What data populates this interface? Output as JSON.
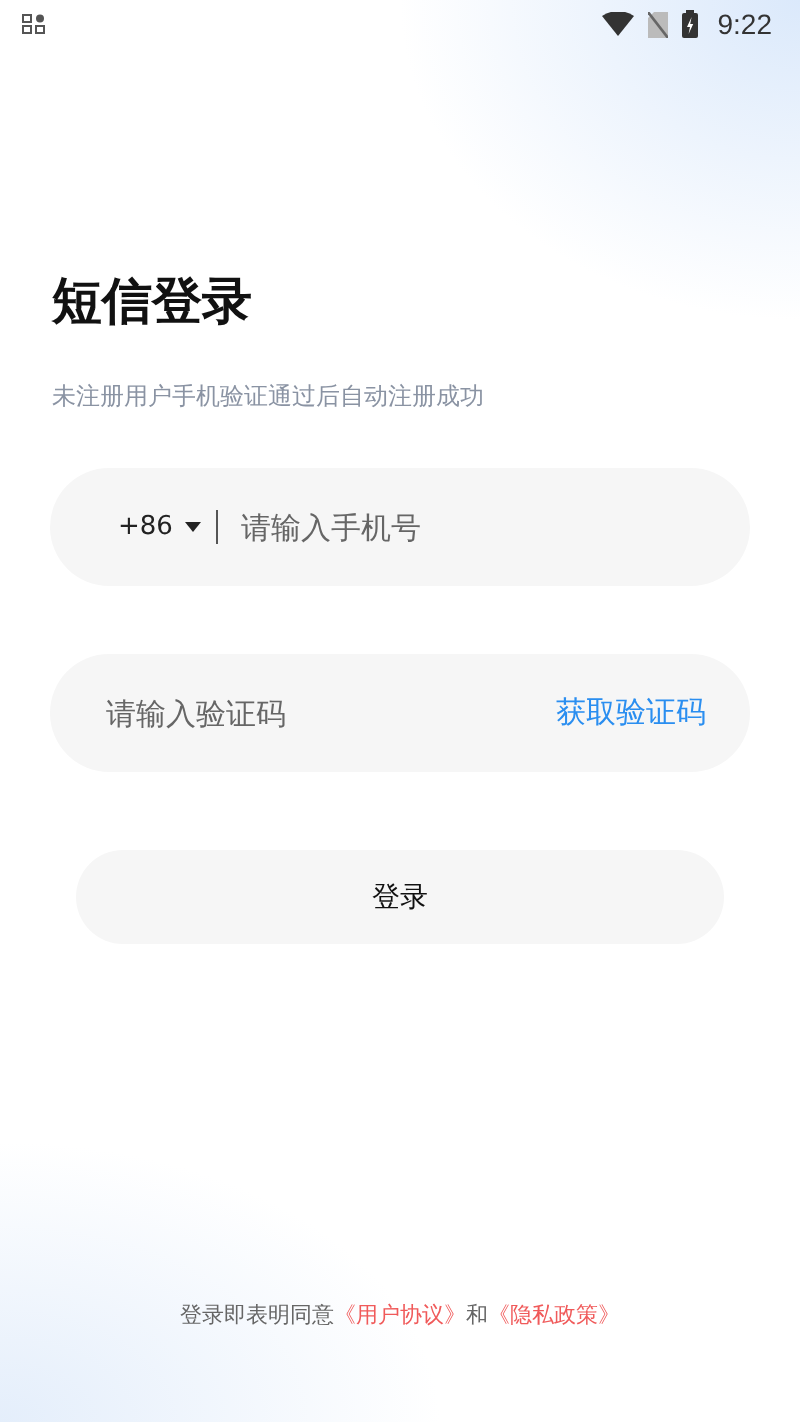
{
  "status_bar": {
    "time": "9:22"
  },
  "title": "短信登录",
  "subtitle": "未注册用户手机验证通过后自动注册成功",
  "phone_field": {
    "country_code": "+86",
    "placeholder": "请输入手机号"
  },
  "code_field": {
    "placeholder": "请输入验证码",
    "action": "获取验证码"
  },
  "login_button": "登录",
  "agreement": {
    "prefix": "登录即表明同意",
    "links": [
      "《用户协议》",
      "《隐私政策》"
    ],
    "joiner": "和"
  }
}
